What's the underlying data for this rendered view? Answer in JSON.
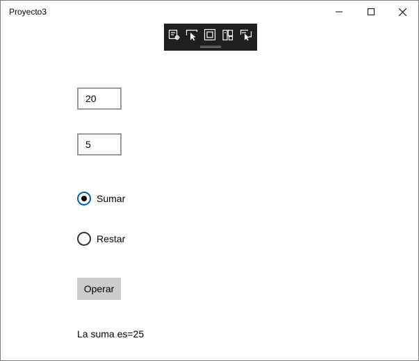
{
  "window": {
    "title": "Proyecto3",
    "controls": {
      "minimize_icon": "minimize-icon",
      "maximize_icon": "maximize-icon",
      "close_icon": "close-icon"
    }
  },
  "debug_toolbar": {
    "icons": [
      "live-visual-tree-icon",
      "select-element-icon",
      "display-layout-adorners-icon",
      "track-focus-icon",
      "preview-selection-icon"
    ]
  },
  "form": {
    "value1": "20",
    "value2": "5",
    "options": [
      {
        "label": "Sumar",
        "checked": true
      },
      {
        "label": "Restar",
        "checked": false
      }
    ],
    "operate_label": "Operar",
    "result_text": "La suma es=25"
  },
  "colors": {
    "accent": "#0063b1",
    "button_bg": "#cccccc",
    "textbox_border": "#999999",
    "debug_toolbar_bg": "#1f1f1f"
  }
}
